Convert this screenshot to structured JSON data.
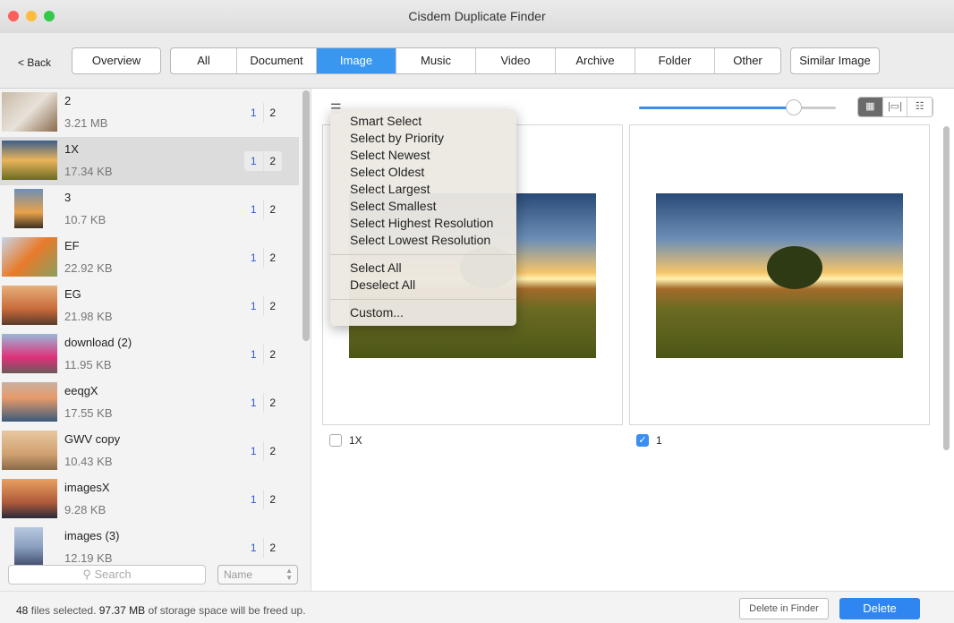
{
  "window": {
    "title": "Cisdem Duplicate Finder"
  },
  "toolbar": {
    "back": "< Back",
    "overview": "Overview",
    "tabs": [
      "All",
      "Document",
      "Image",
      "Music",
      "Video",
      "Archive",
      "Folder",
      "Other"
    ],
    "active_tab": "Image",
    "similar": "Similar Image"
  },
  "files": [
    {
      "name": "2",
      "size": "3.21 MB",
      "c1": "1",
      "c2": "2"
    },
    {
      "name": "1X",
      "size": "17.34 KB",
      "c1": "1",
      "c2": "2"
    },
    {
      "name": "3",
      "size": "10.7 KB",
      "c1": "1",
      "c2": "2"
    },
    {
      "name": "EF",
      "size": "22.92 KB",
      "c1": "1",
      "c2": "2"
    },
    {
      "name": "EG",
      "size": "21.98 KB",
      "c1": "1",
      "c2": "2"
    },
    {
      "name": "download (2)",
      "size": "11.95 KB",
      "c1": "1",
      "c2": "2"
    },
    {
      "name": "eeqgX",
      "size": "17.55 KB",
      "c1": "1",
      "c2": "2"
    },
    {
      "name": "GWV copy",
      "size": "10.43 KB",
      "c1": "1",
      "c2": "2"
    },
    {
      "name": "imagesX",
      "size": "9.28 KB",
      "c1": "1",
      "c2": "2"
    },
    {
      "name": "images (3)",
      "size": "12.19 KB",
      "c1": "1",
      "c2": "2"
    }
  ],
  "sidebar": {
    "search_placeholder": "Search",
    "sort": "Name"
  },
  "preview": {
    "zoom_percent": 78,
    "cards": [
      {
        "label": "1X",
        "checked": false
      },
      {
        "label": "1",
        "checked": true
      }
    ]
  },
  "menu": {
    "group1": [
      "Smart Select",
      "Select by Priority",
      "Select Newest",
      "Select Oldest",
      "Select Largest",
      "Select Smallest",
      "Select Highest Resolution",
      "Select Lowest Resolution"
    ],
    "group2": [
      "Select All",
      "Deselect All"
    ],
    "group3": [
      "Custom..."
    ]
  },
  "status": {
    "count": "48",
    "t1": " files selected. ",
    "size": "97.37 MB",
    "t2": " of storage space will be freed up."
  },
  "actions": {
    "delete_in_finder": "Delete in Finder",
    "delete": "Delete"
  },
  "colors": {
    "accent": "#3a97f0"
  }
}
